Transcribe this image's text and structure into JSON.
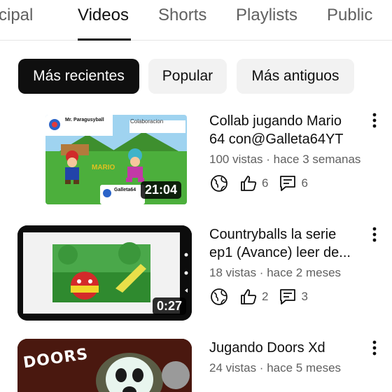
{
  "tabs": [
    {
      "label": "cipal"
    },
    {
      "label": "Videos"
    },
    {
      "label": "Shorts"
    },
    {
      "label": "Playlists"
    },
    {
      "label": "Public"
    }
  ],
  "chips": [
    {
      "label": "Más recientes"
    },
    {
      "label": "Popular"
    },
    {
      "label": "Más antiguos"
    }
  ],
  "videos": [
    {
      "title_line1": "Collab jugando Mario",
      "title_line2": "64 con@Galleta64YT",
      "meta": "100 vistas · hace 3 semanas",
      "duration": "21:04",
      "likes": "6",
      "comments": "6",
      "thumb_text": {
        "channel_a": "Mr. Paragusyball",
        "label": "Colaboracion",
        "channel_b": "Galleta64"
      }
    },
    {
      "title_line1": "Countryballs la serie",
      "title_line2": "ep1 (Avance) leer de...",
      "meta": "18 vistas · hace 2 meses",
      "duration": "0:27",
      "likes": "2",
      "comments": "3"
    },
    {
      "title_line1": "Jugando Doors Xd",
      "meta": "24 vistas · hace 5 meses",
      "thumb_text": {
        "logo": "DOORS"
      }
    }
  ]
}
